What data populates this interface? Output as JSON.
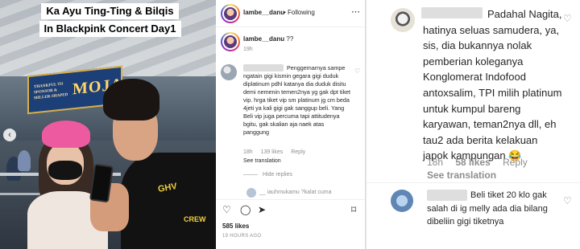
{
  "video": {
    "title_line1": "Ka Ayu Ting-Ting & Bilqis",
    "title_line2": "In Blackpink Concert Day1",
    "sign_text": "MOJA",
    "sign_small": "THANKFUL TO SPONSOR & MILLER-SHAPED",
    "shirt_logo": "GHV",
    "shirt_text": "CREW"
  },
  "post": {
    "username": "lambe__danu",
    "following_label": "• Following",
    "caption_user": "lambe__danu",
    "caption_text": "??",
    "caption_time": "19h"
  },
  "comment": {
    "text": "Penggemarnya sampe ngatain gigi kismin gegara gigi duduk diplatinum pdhl katanya dia duduk disitu demi nemenin temen2nya yg gak dpt tiket vip. hrga tiket vip sm platinum jg cm beda 4jeti ya kali gigi gak sanggup beli. Yang Beli vip juga percuma tapi attitudenya bgitu, gak skalian aja naek atas panggung",
    "time": "18h",
    "likes": "139 likes",
    "reply": "Reply",
    "see_translation": "See translation",
    "hide_replies": "Hide replies",
    "partial_reply": "__ iauhmukamu  ?kalat cuma"
  },
  "actions": {
    "likes": "585 likes",
    "time_ago": "19 HOURS AGO"
  },
  "zoom": {
    "comment1": "Padahal Nagita, hatinya seluas samudera, ya, sis, dia bukannya nolak pemberian koleganya Konglomerat Indofood antoxsalim, TPI milih platinum untuk kumpul bareng karyawan, teman2nya dll, eh tau2 ada berita kelakuan japok kampungan 😂",
    "comment1_time": "18h",
    "comment1_likes": "58 likes",
    "comment1_reply": "Reply",
    "comment1_see_translation": "See translation",
    "comment2": "Beli tiket 20 klo gak salah di ig melly ada dia bilang dibeliin gigi tiketnya"
  },
  "colors": {
    "accent_pink": "#ee5aa0",
    "text_primary": "#262626",
    "text_secondary": "#8e8e8e"
  }
}
